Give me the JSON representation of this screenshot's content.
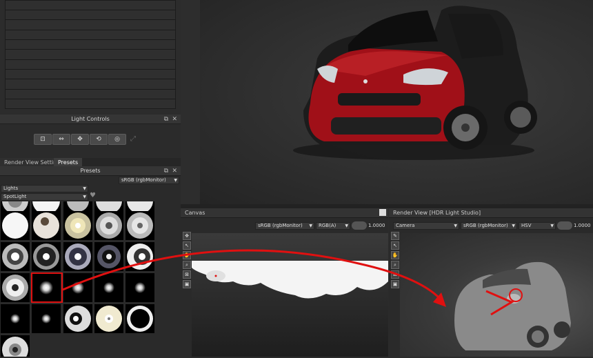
{
  "light_controls": {
    "title": "Light Controls",
    "buttons": [
      {
        "icon": "move-frame-icon",
        "glyph": "⊡"
      },
      {
        "icon": "scale-horizontal-icon",
        "glyph": "⇔"
      },
      {
        "icon": "move-cross-icon",
        "glyph": "✥"
      },
      {
        "icon": "rotate-light-icon",
        "glyph": "⟲"
      },
      {
        "icon": "target-light-icon",
        "glyph": "◎"
      }
    ],
    "disabled_glyph": "⤢"
  },
  "presets_panel": {
    "tabs": [
      "Render View Settings",
      "Presets"
    ],
    "title": "Presets",
    "color_space": "sRGB (rgbMonitor)",
    "category": "Lights",
    "subcategory": "SpotLight"
  },
  "canvas": {
    "title": "Canvas",
    "color_space": "sRGB (rgbMonitor)",
    "channel": "RGB(A)",
    "exposure": "1.0000"
  },
  "render_view": {
    "title": "Render View [HDR Light Studio]",
    "camera": "Camera",
    "color_space": "sRGB (rgbMonitor)",
    "mode": "HSV",
    "exposure": "1.0000"
  },
  "colors": {
    "annotation_red": "#e01010",
    "car_red": "#a01018",
    "panel_bg": "#2a2a2a"
  }
}
